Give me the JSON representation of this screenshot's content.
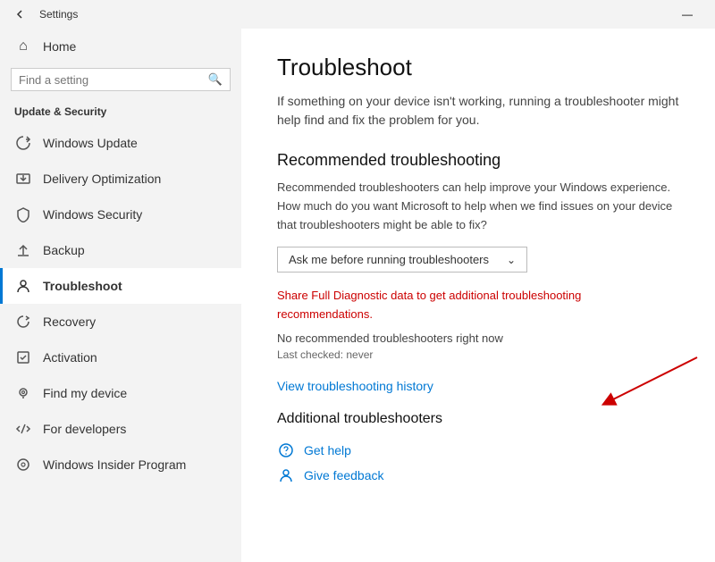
{
  "titlebar": {
    "title": "Settings",
    "min_button": "—"
  },
  "sidebar": {
    "home_label": "Home",
    "search_placeholder": "Find a setting",
    "section_label": "Update & Security",
    "nav_items": [
      {
        "id": "windows-update",
        "label": "Windows Update",
        "icon": "⟳",
        "active": false
      },
      {
        "id": "delivery-optimization",
        "label": "Delivery Optimization",
        "icon": "⬇",
        "active": false
      },
      {
        "id": "windows-security",
        "label": "Windows Security",
        "icon": "🛡",
        "active": false
      },
      {
        "id": "backup",
        "label": "Backup",
        "icon": "↑",
        "active": false
      },
      {
        "id": "troubleshoot",
        "label": "Troubleshoot",
        "icon": "👤",
        "active": true
      },
      {
        "id": "recovery",
        "label": "Recovery",
        "icon": "↺",
        "active": false
      },
      {
        "id": "activation",
        "label": "Activation",
        "icon": "☑",
        "active": false
      },
      {
        "id": "find-my-device",
        "label": "Find my device",
        "icon": "◉",
        "active": false
      },
      {
        "id": "for-developers",
        "label": "For developers",
        "icon": "⟨⟩",
        "active": false
      },
      {
        "id": "windows-insider",
        "label": "Windows Insider Program",
        "icon": "⊙",
        "active": false
      }
    ]
  },
  "main": {
    "title": "Troubleshoot",
    "description": "If something on your device isn't working, running a troubleshooter might help find and fix the problem for you.",
    "recommended_heading": "Recommended troubleshooting",
    "recommended_text": "Recommended troubleshooters can help improve your Windows experience. How much do you want Microsoft to help when we find issues on your device that troubleshooters might be able to fix?",
    "dropdown_label": "Ask me before running troubleshooters",
    "dropdown_chevron": "⌄",
    "diagnostic_link": "Share Full Diagnostic data to get additional troubleshooting recommendations.",
    "status_text": "No recommended troubleshooters right now",
    "last_checked": "Last checked: never",
    "history_link": "View troubleshooting history",
    "additional_heading": "Additional troubleshooters",
    "get_help_label": "Get help",
    "give_feedback_label": "Give feedback",
    "get_help_icon": "💬",
    "give_feedback_icon": "👤"
  }
}
